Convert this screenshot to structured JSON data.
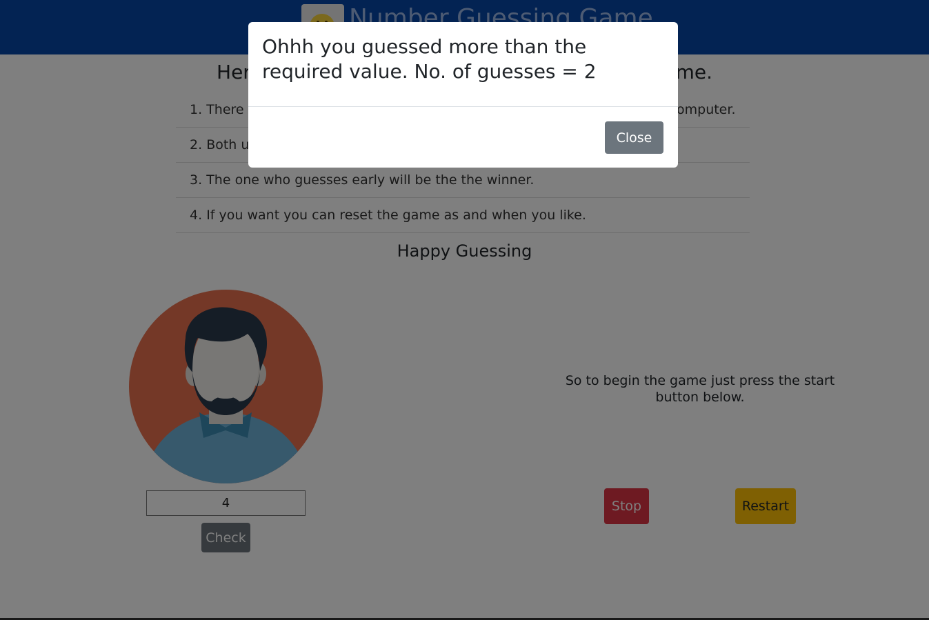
{
  "navbar": {
    "title": "Number Guessing Game",
    "background_color": "#0747a6",
    "logo_icon": "smiley-face-icon"
  },
  "page": {
    "heading_left": "Here",
    "heading_right": "ame.",
    "rules": [
      {
        "number": "1.",
        "text_left": "There a",
        "text_right": "omputer."
      },
      {
        "number": "2.",
        "text_left": "Both us",
        "text_right": ""
      },
      {
        "number": "3.",
        "text_left": "The one who guesses early will be the the winner.",
        "text_right": ""
      },
      {
        "number": "4.",
        "text_left": "If you want you can reset the game as and when you like.",
        "text_right": ""
      }
    ],
    "happy_guessing": "Happy Guessing"
  },
  "player": {
    "avatar_icon": "bearded-man-avatar-icon",
    "guess_value": "4",
    "check_label": "Check"
  },
  "computer": {
    "start_text": "So to begin the game just press the start button below.",
    "stop_label": "Stop",
    "restart_label": "Restart"
  },
  "modal": {
    "message": "Ohhh you guessed more than the required value. No. of guesses = 2",
    "close_label": "Close"
  },
  "colors": {
    "danger": "#dc3545",
    "warning": "#ffc107",
    "secondary": "#6c757d"
  }
}
